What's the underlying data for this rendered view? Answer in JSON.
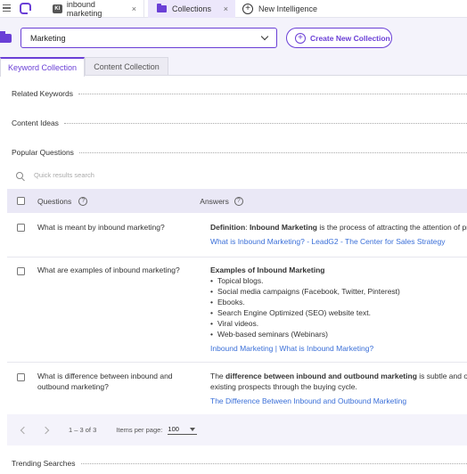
{
  "topbar": {
    "tabs": [
      {
        "badge": "KI",
        "label": "inbound marketing",
        "close": "×"
      },
      {
        "label": "Collections",
        "close": "×"
      },
      {
        "label": "New Intelligence"
      }
    ]
  },
  "header": {
    "selected_collection": "Marketing",
    "new_collection_label": "Create New Collection"
  },
  "collection_tabs": [
    "Keyword Collection",
    "Content Collection"
  ],
  "sections": {
    "related_keywords": "Related Keywords",
    "content_ideas": "Content Ideas",
    "popular_questions": "Popular Questions",
    "trending_searches": "Trending Searches"
  },
  "search": {
    "placeholder": "Quick results search"
  },
  "table": {
    "col_questions": "Questions",
    "col_answers": "Answers",
    "help_glyph": "?",
    "rows": [
      {
        "question": "What is meant by inbound marketing?",
        "answer_b1": "Definition",
        "answer_t1": ": ",
        "answer_b2": "Inbound Marketing",
        "answer_t2": " is the process of attracting the attention of prosp",
        "link": "What is Inbound Marketing? - LeadG2 - The Center for Sales Strategy"
      },
      {
        "question": "What are examples of inbound marketing?",
        "answer_heading": "Examples of Inbound Marketing",
        "bullets": [
          "Topical blogs.",
          "Social media campaigns (Facebook, Twitter, Pinterest)",
          "Ebooks.",
          "Search Engine Optimized (SEO) website text.",
          "Viral videos.",
          "Web-based seminars (Webinars)"
        ],
        "link": "Inbound Marketing | What is Inbound Marketing?"
      },
      {
        "question": "What is difference between inbound and outbound marketing?",
        "answer_t1": "The ",
        "answer_b1": "difference between inbound and outbound marketing",
        "answer_t2": " is subtle and often t",
        "answer_line2": "existing prospects through the buying cycle.",
        "link": "The Difference Between Inbound and Outbound Marketing"
      }
    ]
  },
  "pager": {
    "range": "1 – 3 of 3",
    "items_per_page_label": "Items per page:",
    "items_per_page": "100"
  }
}
